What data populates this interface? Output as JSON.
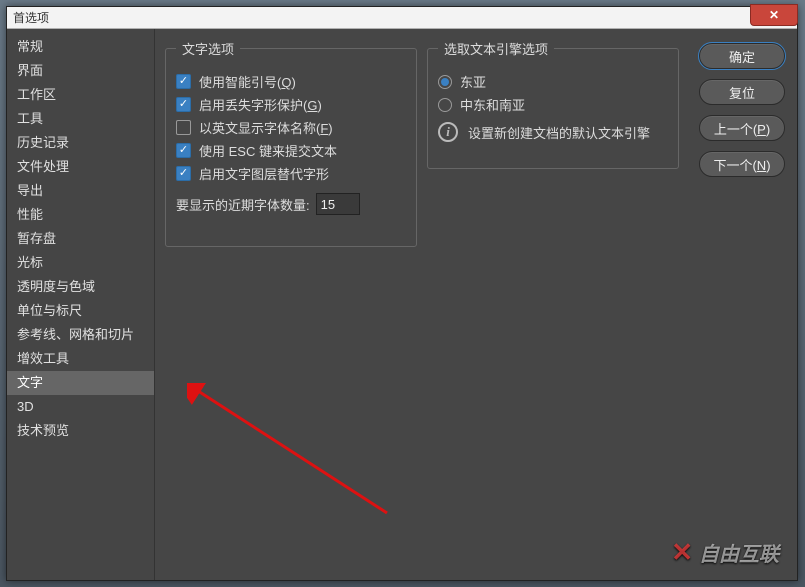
{
  "dialog": {
    "title": "首选项",
    "close_glyph": "✕"
  },
  "sidebar": {
    "items": [
      "常规",
      "界面",
      "工作区",
      "工具",
      "历史记录",
      "文件处理",
      "导出",
      "性能",
      "暂存盘",
      "光标",
      "透明度与色域",
      "单位与标尺",
      "参考线、网格和切片",
      "增效工具",
      "文字",
      "3D",
      "技术预览"
    ],
    "selected_index": 14
  },
  "type_options": {
    "legend": "文字选项",
    "items": [
      {
        "label_pre": "使用智能引号(",
        "hot": "Q",
        "label_post": ")",
        "checked": true
      },
      {
        "label_pre": "启用丢失字形保护(",
        "hot": "G",
        "label_post": ")",
        "checked": true
      },
      {
        "label_pre": "以英文显示字体名称(",
        "hot": "F",
        "label_post": ")",
        "checked": false
      },
      {
        "label_pre": "使用 ESC 键来提交文本",
        "hot": "",
        "label_post": "",
        "checked": true
      },
      {
        "label_pre": "启用文字图层替代字形",
        "hot": "",
        "label_post": "",
        "checked": true
      }
    ],
    "recent_label": "要显示的近期字体数量:",
    "recent_value": "15"
  },
  "engine": {
    "legend": "选取文本引擎选项",
    "options": [
      {
        "label": "东亚",
        "checked": true
      },
      {
        "label": "中东和南亚",
        "checked": false
      }
    ],
    "info": "设置新创建文档的默认文本引擎"
  },
  "buttons": {
    "ok": "确定",
    "reset": "复位",
    "prev_pre": "上一个(",
    "prev_hot": "P",
    "prev_post": ")",
    "next_pre": "下一个(",
    "next_hot": "N",
    "next_post": ")"
  },
  "watermark": "自由互联"
}
